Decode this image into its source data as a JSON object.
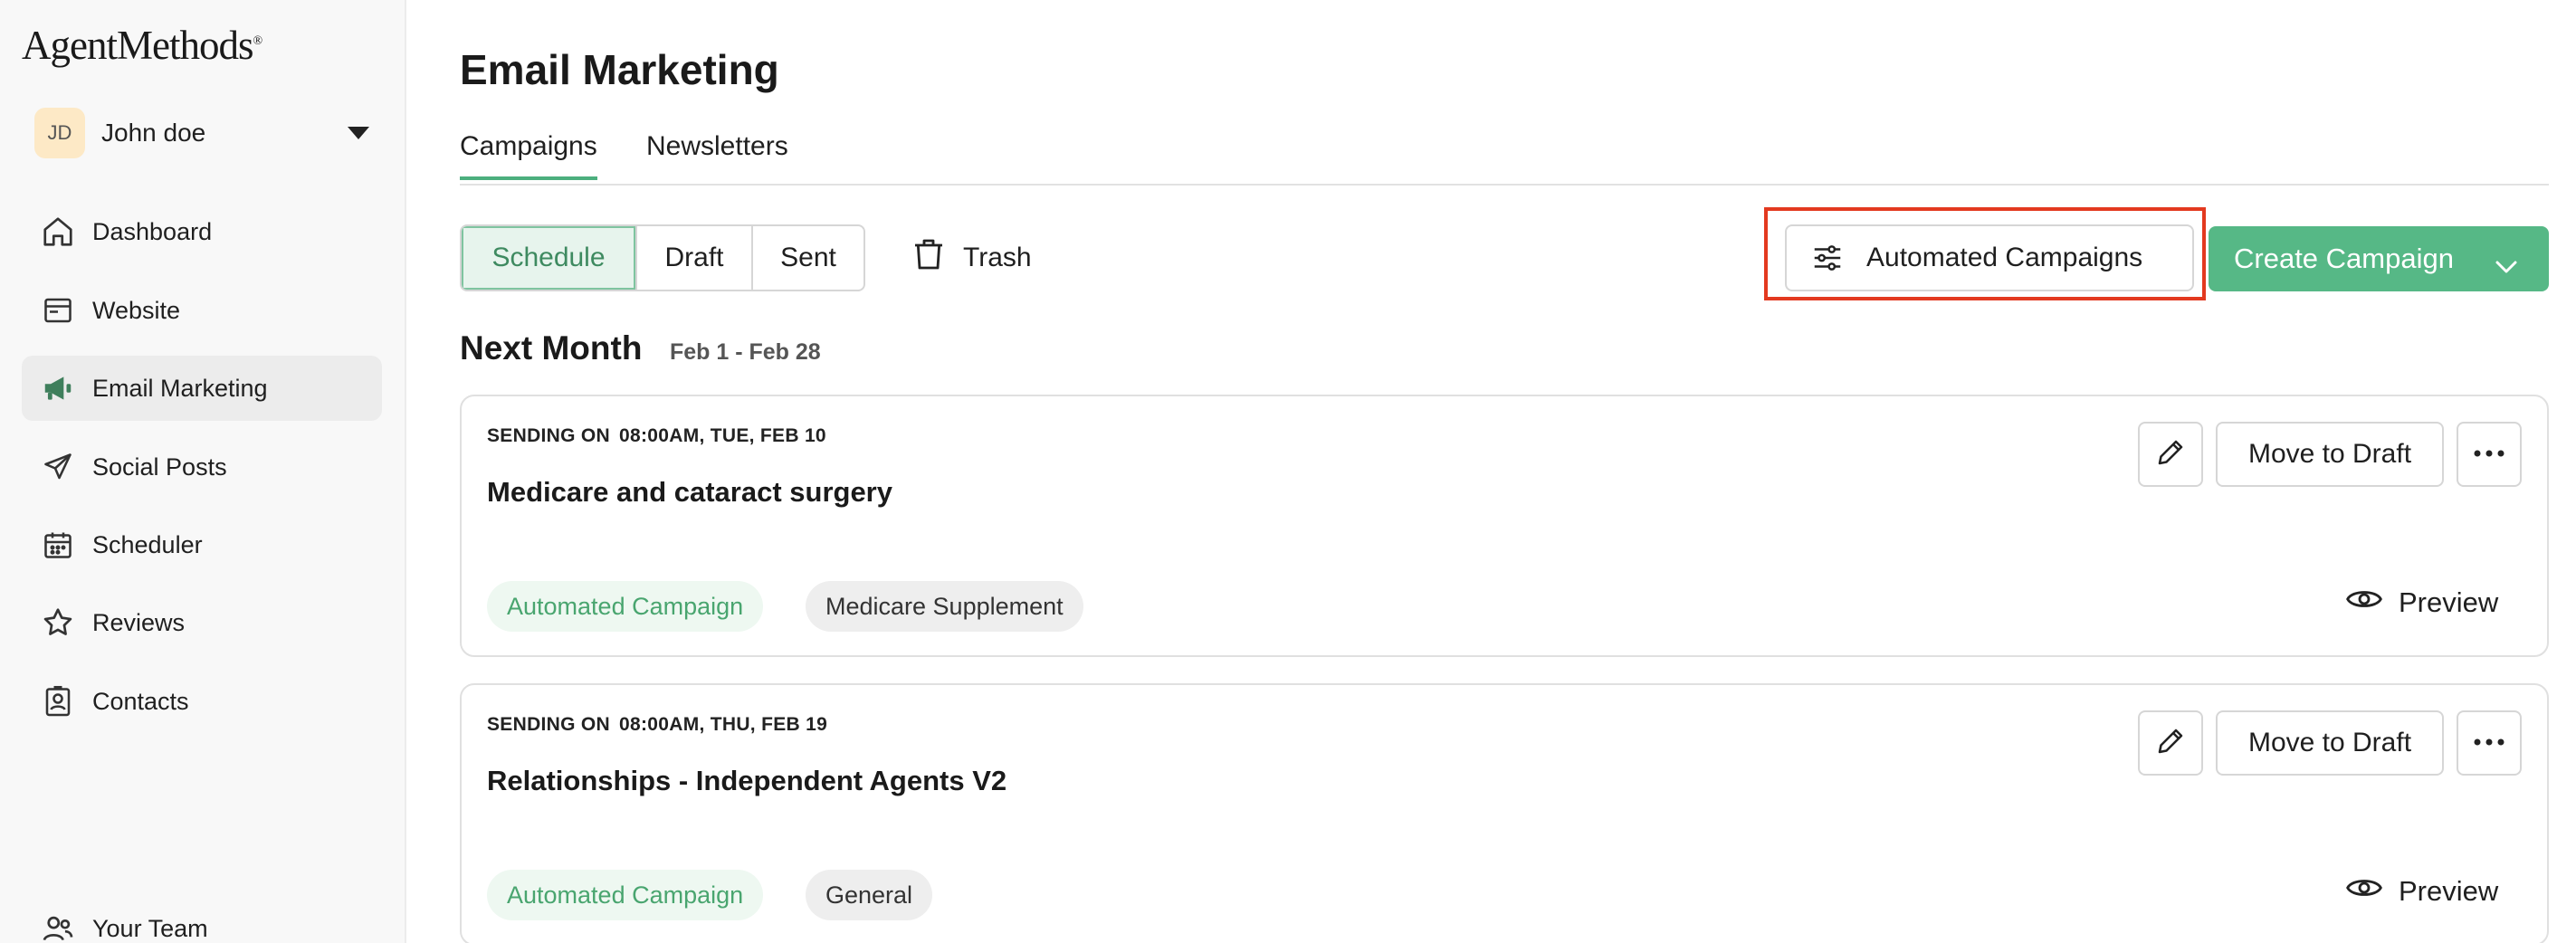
{
  "app": {
    "logo": "AgentMethods",
    "logo_mark": "®"
  },
  "user": {
    "initials": "JD",
    "name": "John doe"
  },
  "sidebar": {
    "items": [
      {
        "label": "Dashboard",
        "icon": "home-icon"
      },
      {
        "label": "Website",
        "icon": "browser-icon"
      },
      {
        "label": "Email Marketing",
        "icon": "megaphone-icon",
        "active": true
      },
      {
        "label": "Social Posts",
        "icon": "paper-plane-icon"
      },
      {
        "label": "Scheduler",
        "icon": "calendar-icon"
      },
      {
        "label": "Reviews",
        "icon": "star-icon"
      },
      {
        "label": "Contacts",
        "icon": "contact-card-icon"
      },
      {
        "label": "Your Team",
        "icon": "team-icon"
      }
    ]
  },
  "main": {
    "title": "Email Marketing",
    "tabs": [
      {
        "label": "Campaigns",
        "active": true
      },
      {
        "label": "Newsletters"
      }
    ],
    "filters": [
      {
        "label": "Schedule",
        "active": true
      },
      {
        "label": "Draft"
      },
      {
        "label": "Sent"
      }
    ],
    "trash_label": "Trash",
    "automated_label": "Automated Campaigns",
    "create_label": "Create Campaign",
    "section": {
      "title": "Next Month",
      "range": "Feb 1 - Feb 28"
    },
    "campaigns": [
      {
        "send_prefix": "SENDING ON",
        "send_when": "08:00AM, TUE, FEB 10",
        "title": "Medicare and cataract surgery",
        "tags": [
          "Automated Campaign",
          "Medicare Supplement"
        ],
        "move_label": "Move to Draft",
        "preview_label": "Preview"
      },
      {
        "send_prefix": "SENDING ON",
        "send_when": "08:00AM, THU, FEB 19",
        "title": "Relationships - Independent Agents V2",
        "tags": [
          "Automated Campaign",
          "General"
        ],
        "move_label": "Move to Draft",
        "preview_label": "Preview"
      }
    ]
  },
  "colors": {
    "accent_green": "#56b886",
    "highlight_red": "#e3391f",
    "avatar_bg": "#fde9c6"
  }
}
